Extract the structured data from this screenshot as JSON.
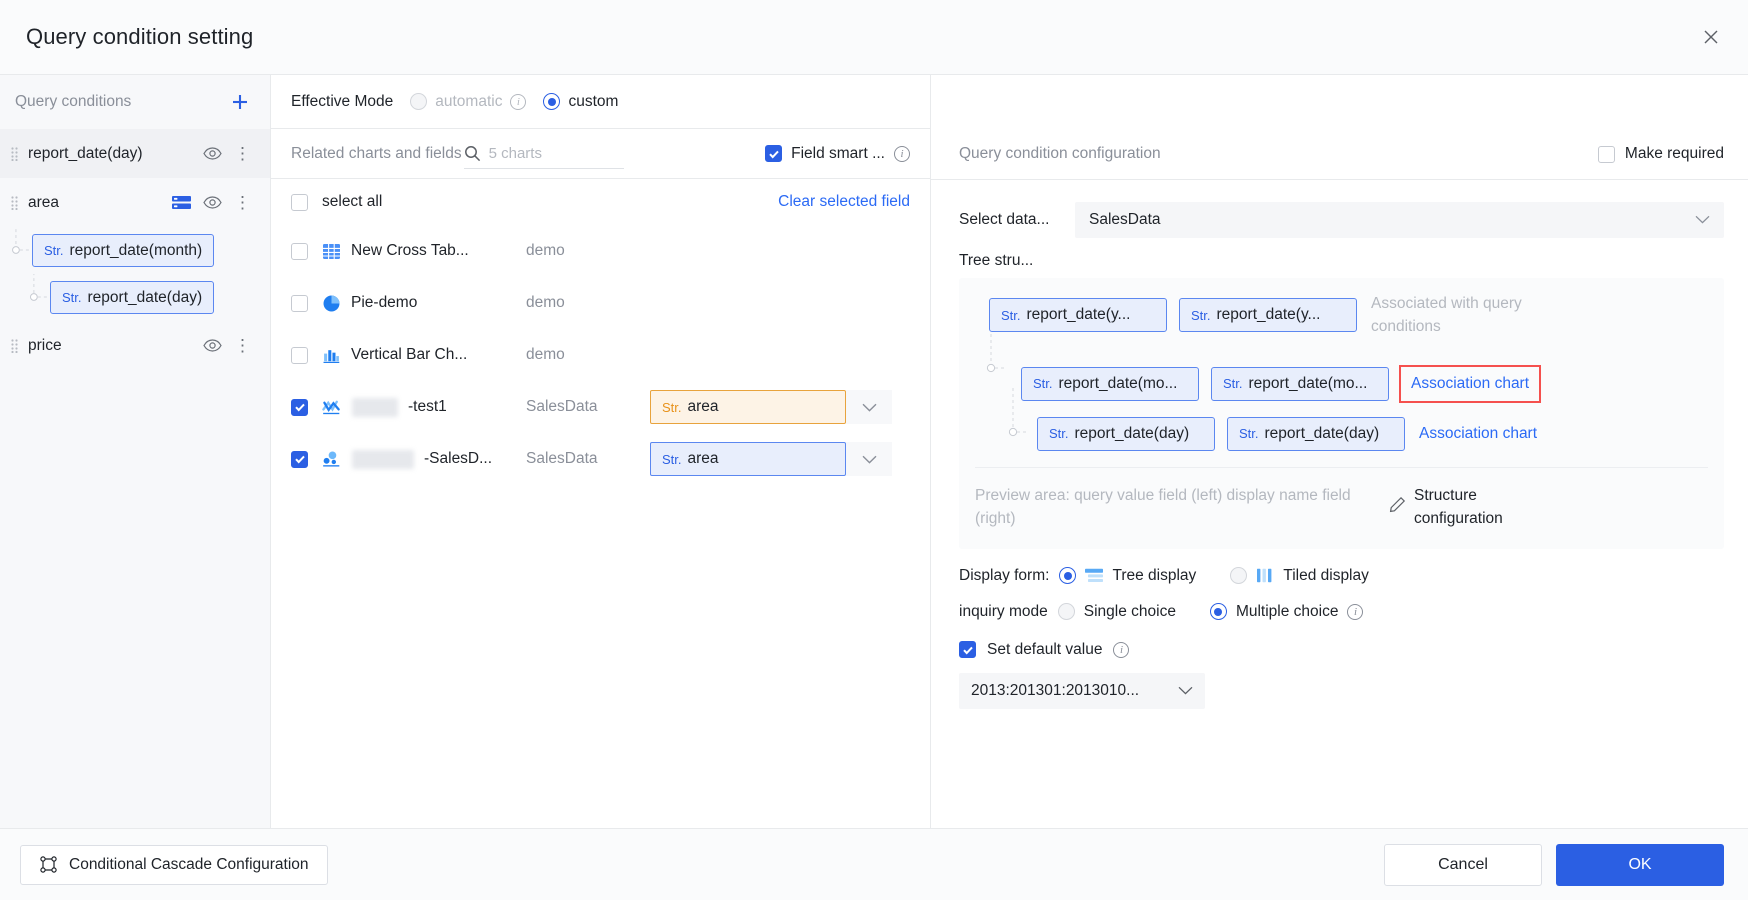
{
  "dialog": {
    "title": "Query condition setting",
    "close_icon": "close-icon"
  },
  "sidebar": {
    "header": "Query conditions",
    "add_icon": "plus-icon",
    "items": [
      {
        "label": "report_date(day)",
        "selected": true,
        "has_tree_icon": false
      },
      {
        "label": "area",
        "selected": false,
        "has_tree_icon": true
      },
      {
        "label": "price",
        "selected": false,
        "has_tree_icon": false
      }
    ],
    "area_children": [
      {
        "label": "report_date(month)",
        "type": "Str."
      },
      {
        "label": "report_date(day)",
        "type": "Str."
      }
    ]
  },
  "effective_mode": {
    "label": "Effective Mode",
    "options": [
      {
        "label": "automatic",
        "checked": false,
        "disabled": true,
        "has_info": true
      },
      {
        "label": "custom",
        "checked": true,
        "disabled": false,
        "has_info": false
      }
    ]
  },
  "related": {
    "label": "Related charts and fields",
    "search_icon": "search-icon",
    "search_value": "",
    "search_placeholder": "5 charts",
    "field_smart_label": "Field smart ...",
    "field_smart_checked": true,
    "select_all_label": "select all",
    "select_all_checked": false,
    "clear_link": "Clear selected field",
    "rows": [
      {
        "checked": false,
        "icon": "cross-table-icon",
        "name": "New Cross Tab...",
        "blurred": false,
        "source": "demo",
        "field": null
      },
      {
        "checked": false,
        "icon": "pie-chart-icon",
        "name": "Pie-demo",
        "blurred": false,
        "source": "demo",
        "field": null
      },
      {
        "checked": false,
        "icon": "bar-chart-icon",
        "name": "Vertical Bar Ch...",
        "blurred": false,
        "source": "demo",
        "field": null
      },
      {
        "checked": true,
        "icon": "line-chart-icon",
        "name": "-test1",
        "blurred": true,
        "source": "SalesData",
        "field": {
          "type": "Str.",
          "value": "area",
          "style": "orange"
        }
      },
      {
        "checked": true,
        "icon": "bubble-chart-icon",
        "name": "-SalesD...",
        "blurred": true,
        "source": "SalesData",
        "field": {
          "type": "Str.",
          "value": "area",
          "style": "blue"
        }
      }
    ]
  },
  "config": {
    "header": "Query condition configuration",
    "make_required_label": "Make required",
    "make_required_checked": false,
    "select_data_label": "Select data...",
    "select_data_value": "SalesData",
    "tree_struct_label": "Tree stru...",
    "tree_rows": [
      {
        "level": 0,
        "chips": [
          {
            "type": "Str.",
            "label": "report_date(y..."
          },
          {
            "type": "Str.",
            "label": "report_date(y..."
          }
        ],
        "note": "Associated with query conditions",
        "link": null,
        "highlighted": false
      },
      {
        "level": 1,
        "chips": [
          {
            "type": "Str.",
            "label": "report_date(mo..."
          },
          {
            "type": "Str.",
            "label": "report_date(mo..."
          }
        ],
        "note": null,
        "link": "Association chart",
        "highlighted": true
      },
      {
        "level": 2,
        "chips": [
          {
            "type": "Str.",
            "label": "report_date(day)"
          },
          {
            "type": "Str.",
            "label": "report_date(day)"
          }
        ],
        "note": null,
        "link": "Association chart",
        "highlighted": false
      }
    ],
    "preview_text": "Preview area: query value field (left) display name field (right)",
    "structure_config_label": "Structure configuration",
    "pencil_icon": "pencil-icon",
    "display_form": {
      "label": "Display form:",
      "options": [
        {
          "label": "Tree display",
          "checked": true,
          "icon": "tree-display-icon"
        },
        {
          "label": "Tiled display",
          "checked": false,
          "icon": "tiled-display-icon"
        }
      ]
    },
    "inquiry_mode": {
      "label": "inquiry mode",
      "options": [
        {
          "label": "Single choice",
          "checked": false,
          "has_info": false
        },
        {
          "label": "Multiple choice",
          "checked": true,
          "has_info": true
        }
      ]
    },
    "set_default": {
      "label": "Set default value",
      "checked": true,
      "has_info": true,
      "value": "2013:201301:2013010..."
    }
  },
  "footer": {
    "cascade_label": "Conditional Cascade Configuration",
    "cascade_icon": "cascade-icon",
    "cancel_label": "Cancel",
    "ok_label": "OK"
  },
  "colors": {
    "accent": "#2b5fe3",
    "link": "#2b6af5",
    "highlight": "#f5504e",
    "orange": "#e8a33d"
  }
}
